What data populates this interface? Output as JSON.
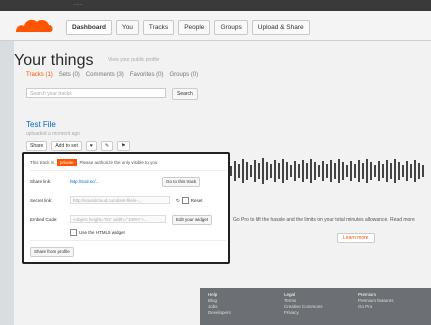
{
  "topbar": {
    "strip_text": "......"
  },
  "nav": {
    "items": [
      {
        "label": "Dashboard",
        "active": true
      },
      {
        "label": "You",
        "active": false
      },
      {
        "label": "Tracks",
        "active": false
      },
      {
        "label": "People",
        "active": false
      },
      {
        "label": "Groups",
        "active": false
      },
      {
        "label": "Upload & Share",
        "active": false
      }
    ]
  },
  "page": {
    "title": "Your things",
    "subtitle": "View your public profile",
    "tabs": [
      "Tracks (1)",
      "Sets (0)",
      "Comments (3)",
      "Favorites (0)",
      "Groups (0)"
    ],
    "search_placeholder": "Search your tracks",
    "search_button": "Search"
  },
  "track": {
    "title": "Test File",
    "meta": "uploaded a moment ago",
    "actions": [
      "Share",
      "Add to set",
      "♥",
      "✎",
      "⚑"
    ]
  },
  "popup": {
    "private_prefix": "This track is",
    "private_badge": "private",
    "private_suffix": "Please authorize the only visible to you",
    "share_link_label": "Share link:",
    "share_link_value": "http://snd.sc/...",
    "share_link_button": "Go to this track",
    "secret_link_label": "Secret link:",
    "secret_link_value": "http://soundcloud.com/test-file/s-...",
    "secret_link_reset": "Reset",
    "embed_label": "Embed Code:",
    "embed_value": "<object height=\"81\" width=\"100%\">...",
    "embed_button": "Edit your widget",
    "html5_checkbox": "Use the HTML5 widget",
    "share_profile_button": "Share from profile"
  },
  "pro_panel": {
    "text": "Go Pro to lift the hassle and the limits on your total minutes allowance. Read more",
    "learn_more": "Learn more"
  },
  "footer": {
    "columns": [
      {
        "title": "Help",
        "items": [
          "Blog",
          "Jobs",
          "Developers"
        ]
      },
      {
        "title": "Legal",
        "items": [
          "Terms",
          "Creative Commons",
          "Privacy"
        ]
      },
      {
        "title": "Premium",
        "items": [
          "Premium features",
          "Go Pro"
        ]
      }
    ]
  }
}
